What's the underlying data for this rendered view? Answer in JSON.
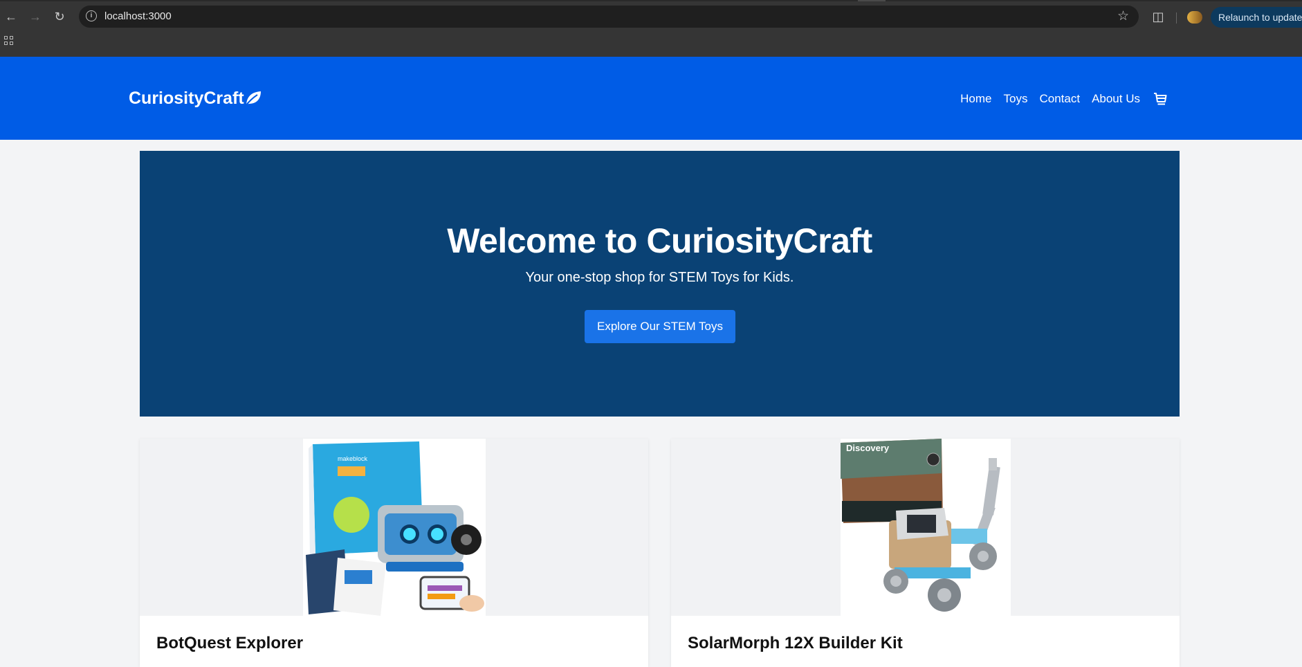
{
  "browser": {
    "url": "localhost:3000",
    "relaunch_label": "Relaunch to update",
    "icons": [
      "back-arrow-icon",
      "forward-arrow-icon",
      "reload-icon",
      "info-icon",
      "star-icon",
      "extensions-icon",
      "profile-avatar-icon",
      "apps-grid-icon"
    ]
  },
  "header": {
    "brand": "CuriosityCraft",
    "brand_icon": "leaf-icon",
    "nav": [
      "Home",
      "Toys",
      "Contact",
      "About Us"
    ],
    "cart_icon": "cart-icon",
    "bg_color": "#005ce6"
  },
  "hero": {
    "title": "Welcome to CuriosityCraft",
    "subtitle": "Your one-stop shop for STEM Toys for Kids.",
    "cta_label": "Explore Our STEM Toys",
    "bg_color": "#0a4275",
    "cta_color": "#1a73e8"
  },
  "products": [
    {
      "title": "BotQuest Explorer"
    },
    {
      "title": "SolarMorph 12X Builder Kit"
    }
  ]
}
